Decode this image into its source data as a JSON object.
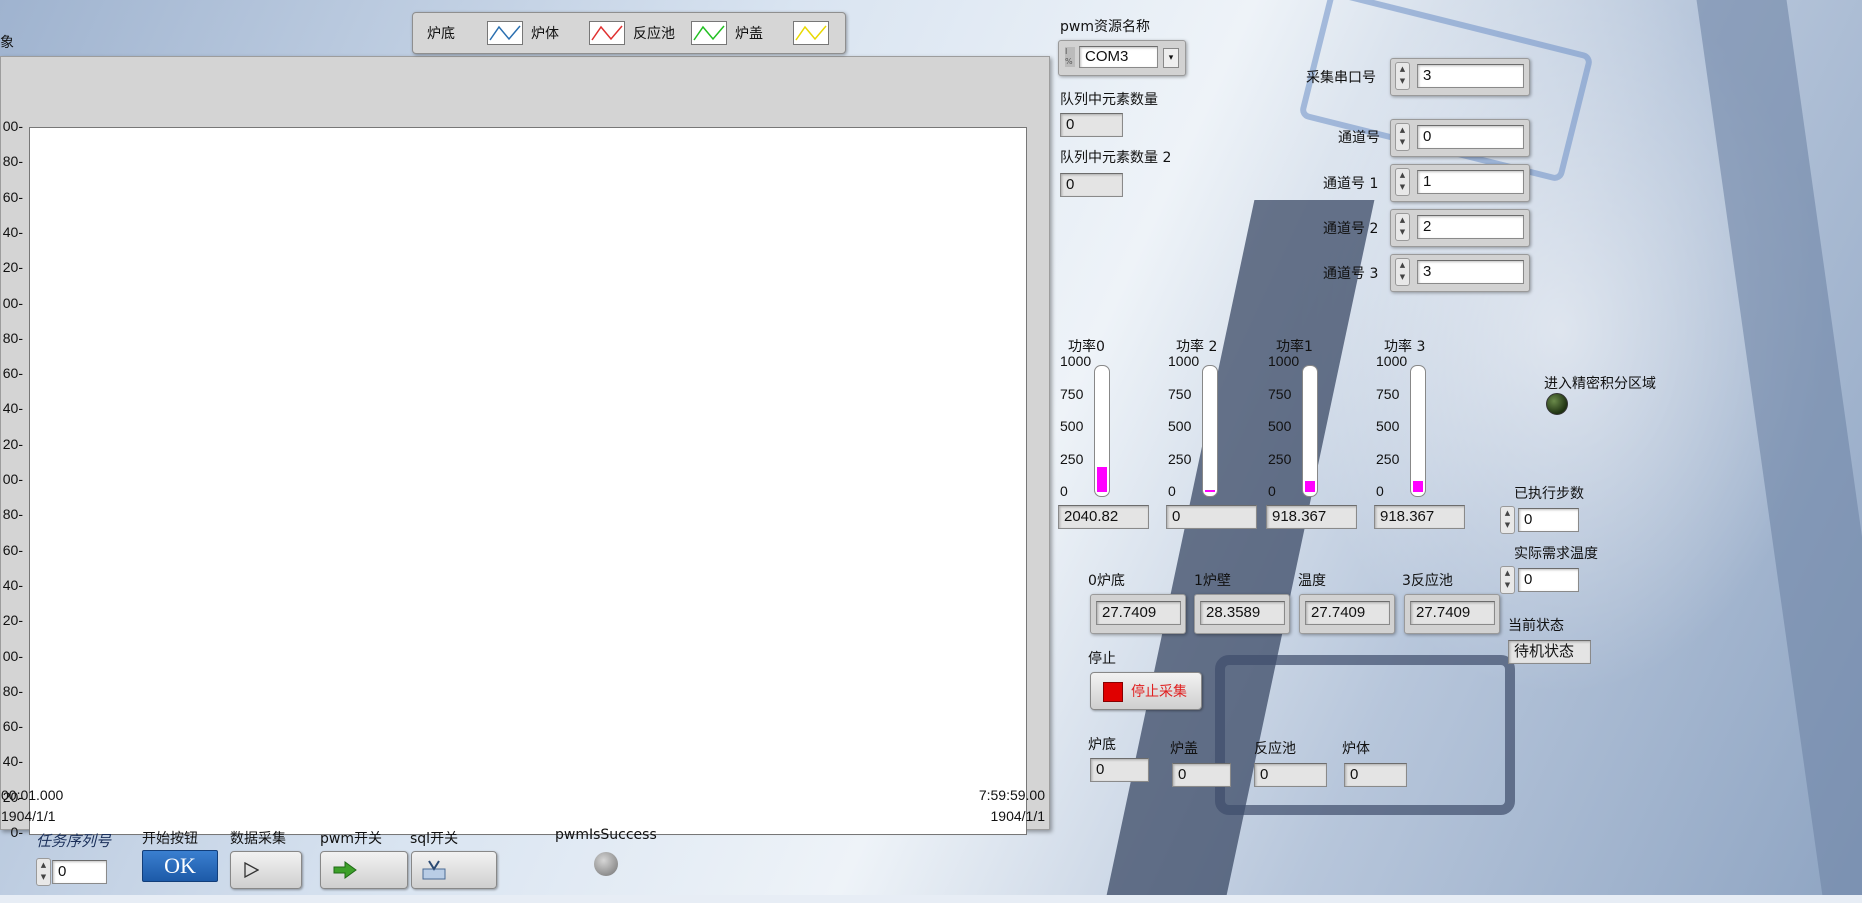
{
  "graph": {
    "title_fragment": "象",
    "y_ticks": [
      "00-",
      "80-",
      "60-",
      "40-",
      "20-",
      "00-",
      "80-",
      "60-",
      "40-",
      "20-",
      "00-",
      "80-",
      "60-",
      "40-",
      "20-",
      "00-",
      "80-",
      "60-",
      "40-",
      "20-",
      "0-"
    ],
    "x_start_time": "00:01.000",
    "x_start_date": "1904/1/1",
    "x_end_time": "7:59:59.00",
    "x_end_date": "1904/1/1"
  },
  "legend": {
    "items": [
      {
        "label": "炉底",
        "color": ""
      },
      {
        "label": "炉体",
        "color": "#2a6fb0"
      },
      {
        "label": "反应池",
        "color": "#e03030"
      },
      {
        "label": "炉盖",
        "color": "#22c022"
      },
      {
        "label": "",
        "color": "#e8d800"
      }
    ]
  },
  "pwm_resource": {
    "label": "pwm资源名称",
    "value": "COM3"
  },
  "queue": {
    "label1": "队列中元素数量",
    "value1": "0",
    "label2": "队列中元素数量 2",
    "value2": "0"
  },
  "serial": {
    "acq_port_label": "采集串口号",
    "acq_port_value": "3",
    "channels": [
      {
        "label": "通道号",
        "value": "0"
      },
      {
        "label": "通道号 1",
        "value": "1"
      },
      {
        "label": "通道号 2",
        "value": "2"
      },
      {
        "label": "通道号 3",
        "value": "3"
      }
    ]
  },
  "power": {
    "scale": [
      "1000",
      "750",
      "500",
      "250",
      "0"
    ],
    "meters": [
      {
        "label": "功率0",
        "value": "2040.82",
        "fraction": 0.2
      },
      {
        "label": "功率 2",
        "value": "0",
        "fraction": 0.01
      },
      {
        "label": "功率1",
        "value": "918.367",
        "fraction": 0.09
      },
      {
        "label": "功率 3",
        "value": "918.367",
        "fraction": 0.09
      }
    ]
  },
  "temps": [
    {
      "label": "0炉底",
      "value": "27.7409"
    },
    {
      "label": "1炉壁",
      "value": "28.3589"
    },
    {
      "label": "温度",
      "value": "27.7409"
    },
    {
      "label": "3反应池",
      "value": "27.7409"
    }
  ],
  "stop": {
    "label": "停止",
    "button": "停止采集"
  },
  "bottom_fields": [
    {
      "label": "炉底",
      "value": "0"
    },
    {
      "label": "炉盖",
      "value": "0"
    },
    {
      "label": "反应池",
      "value": "0"
    },
    {
      "label": "炉体",
      "value": "0"
    }
  ],
  "precision_led": {
    "label": "进入精密积分区域"
  },
  "steps": {
    "label": "已执行步数",
    "value": "0"
  },
  "required_temp": {
    "label": "实际需求温度",
    "value": "0"
  },
  "state": {
    "label": "当前状态",
    "value": "待机状态"
  },
  "toolbar": {
    "task_label": "任务序列号",
    "task_value": "0",
    "start_label": "开始按钮",
    "ok_text": "OK",
    "acq_label": "数据采集",
    "pwm_label": "pwm开关",
    "sql_label": "sql开关",
    "pwm_success_label": "pwmIsSuccess"
  }
}
